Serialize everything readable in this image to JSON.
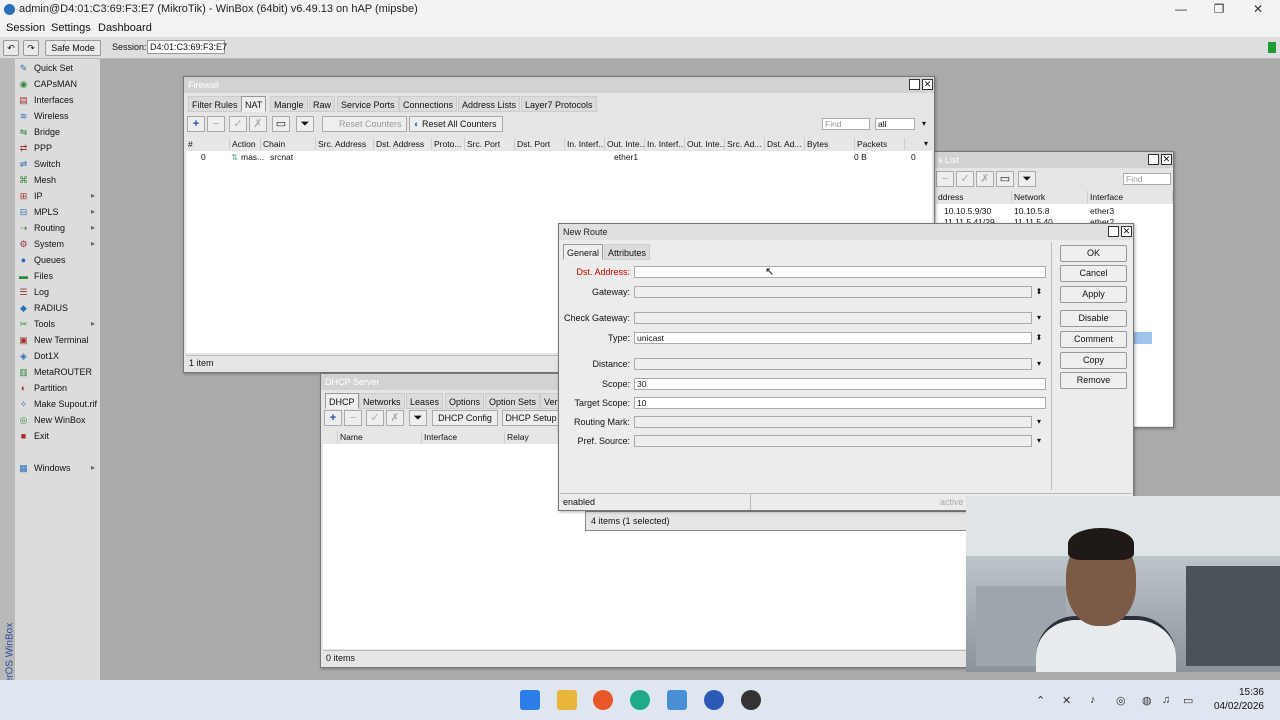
{
  "window": {
    "title": "admin@D4:01:C3:69:F3:E7 (MikroTik) - WinBox (64bit) v6.49.13 on hAP (mipsbe)"
  },
  "menu": [
    "Session",
    "Settings",
    "Dashboard"
  ],
  "toolbar": {
    "safe_mode": "Safe Mode",
    "session_label": "Session:",
    "session_value": "D4:01:C3:69:F3:E7"
  },
  "sidebar": {
    "vertical_label": "RouterOS WinBox",
    "items": [
      {
        "label": "Quick Set",
        "icon": "quickset-icon",
        "arrow": false
      },
      {
        "label": "CAPsMAN",
        "icon": "capsman-icon",
        "arrow": false
      },
      {
        "label": "Interfaces",
        "icon": "interfaces-icon",
        "arrow": false
      },
      {
        "label": "Wireless",
        "icon": "wireless-icon",
        "arrow": false
      },
      {
        "label": "Bridge",
        "icon": "bridge-icon",
        "arrow": false
      },
      {
        "label": "PPP",
        "icon": "ppp-icon",
        "arrow": false
      },
      {
        "label": "Switch",
        "icon": "switch-icon",
        "arrow": false
      },
      {
        "label": "Mesh",
        "icon": "mesh-icon",
        "arrow": false
      },
      {
        "label": "IP",
        "icon": "ip-icon",
        "arrow": true
      },
      {
        "label": "MPLS",
        "icon": "mpls-icon",
        "arrow": true
      },
      {
        "label": "Routing",
        "icon": "routing-icon",
        "arrow": true
      },
      {
        "label": "System",
        "icon": "system-icon",
        "arrow": true
      },
      {
        "label": "Queues",
        "icon": "queues-icon",
        "arrow": false
      },
      {
        "label": "Files",
        "icon": "files-icon",
        "arrow": false
      },
      {
        "label": "Log",
        "icon": "log-icon",
        "arrow": false
      },
      {
        "label": "RADIUS",
        "icon": "radius-icon",
        "arrow": false
      },
      {
        "label": "Tools",
        "icon": "tools-icon",
        "arrow": true
      },
      {
        "label": "New Terminal",
        "icon": "terminal-icon",
        "arrow": false
      },
      {
        "label": "Dot1X",
        "icon": "dot1x-icon",
        "arrow": false
      },
      {
        "label": "MetaROUTER",
        "icon": "metarouter-icon",
        "arrow": false
      },
      {
        "label": "Partition",
        "icon": "partition-icon",
        "arrow": false
      },
      {
        "label": "Make Supout.rif",
        "icon": "supout-icon",
        "arrow": false
      },
      {
        "label": "New WinBox",
        "icon": "winbox-icon",
        "arrow": false
      },
      {
        "label": "Exit",
        "icon": "exit-icon",
        "arrow": false
      }
    ],
    "windows_label": "Windows"
  },
  "firewall": {
    "title": "Firewall",
    "tabs": [
      "Filter Rules",
      "NAT",
      "Mangle",
      "Raw",
      "Service Ports",
      "Connections",
      "Address Lists",
      "Layer7 Protocols"
    ],
    "reset_counters": "Reset Counters",
    "reset_all_counters": "Reset All Counters",
    "find_placeholder": "Find",
    "filter_value": "all",
    "columns": [
      "#",
      "Action",
      "Chain",
      "Src. Address",
      "Dst. Address",
      "Proto...",
      "Src. Port",
      "Dst. Port",
      "In. Interf...",
      "Out. Inte...",
      "In. Interf...",
      "Out. Inte...",
      "Src. Ad...",
      "Dst. Ad...",
      "Bytes",
      "Packets"
    ],
    "row": {
      "num": "0",
      "action": "mas...",
      "chain": "srcnat",
      "out_iface": "ether1",
      "bytes": "0 B",
      "packets": "0"
    },
    "status": "1 item"
  },
  "address_list": {
    "title": "s List",
    "find_placeholder": "Find",
    "columns": [
      "ddress",
      "Network",
      "Interface"
    ],
    "rows": [
      {
        "address": "10.10.5.9/30",
        "network": "10.10.5.8",
        "interface": "ether3"
      },
      {
        "address": "11.11.5.41/29",
        "network": "11.11.5.40",
        "interface": "ether2"
      }
    ],
    "status": "4 items (1 selected)"
  },
  "dhcp": {
    "title": "DHCP Server",
    "tabs": [
      "DHCP",
      "Networks",
      "Leases",
      "Options",
      "Option Sets",
      "Ver"
    ],
    "dhcp_config": "DHCP Config",
    "dhcp_setup": "DHCP Setup",
    "columns": [
      "Name",
      "Interface",
      "Relay"
    ],
    "status": "0 items"
  },
  "route": {
    "title": "New Route",
    "tabs": [
      "General",
      "Attributes"
    ],
    "fields": {
      "dst_address": {
        "label": "Dst. Address:",
        "value": ""
      },
      "gateway": {
        "label": "Gateway:",
        "value": ""
      },
      "check_gateway": {
        "label": "Check Gateway:",
        "value": ""
      },
      "type": {
        "label": "Type:",
        "value": "unicast"
      },
      "distance": {
        "label": "Distance:",
        "value": ""
      },
      "scope": {
        "label": "Scope:",
        "value": "30"
      },
      "target_scope": {
        "label": "Target Scope:",
        "value": "10"
      },
      "routing_mark": {
        "label": "Routing Mark:",
        "value": ""
      },
      "pref_source": {
        "label": "Pref. Source:",
        "value": ""
      }
    },
    "buttons": [
      "OK",
      "Cancel",
      "Apply",
      "Disable",
      "Comment",
      "Copy",
      "Remove"
    ],
    "status_enabled": "enabled",
    "status_active": "active"
  },
  "taskbar": {
    "time": "15:36",
    "date": "04/02/2026"
  },
  "colors": {
    "accent": "#2a6fb8",
    "required_label": "#c00000",
    "green_status": "#1e9b32"
  }
}
